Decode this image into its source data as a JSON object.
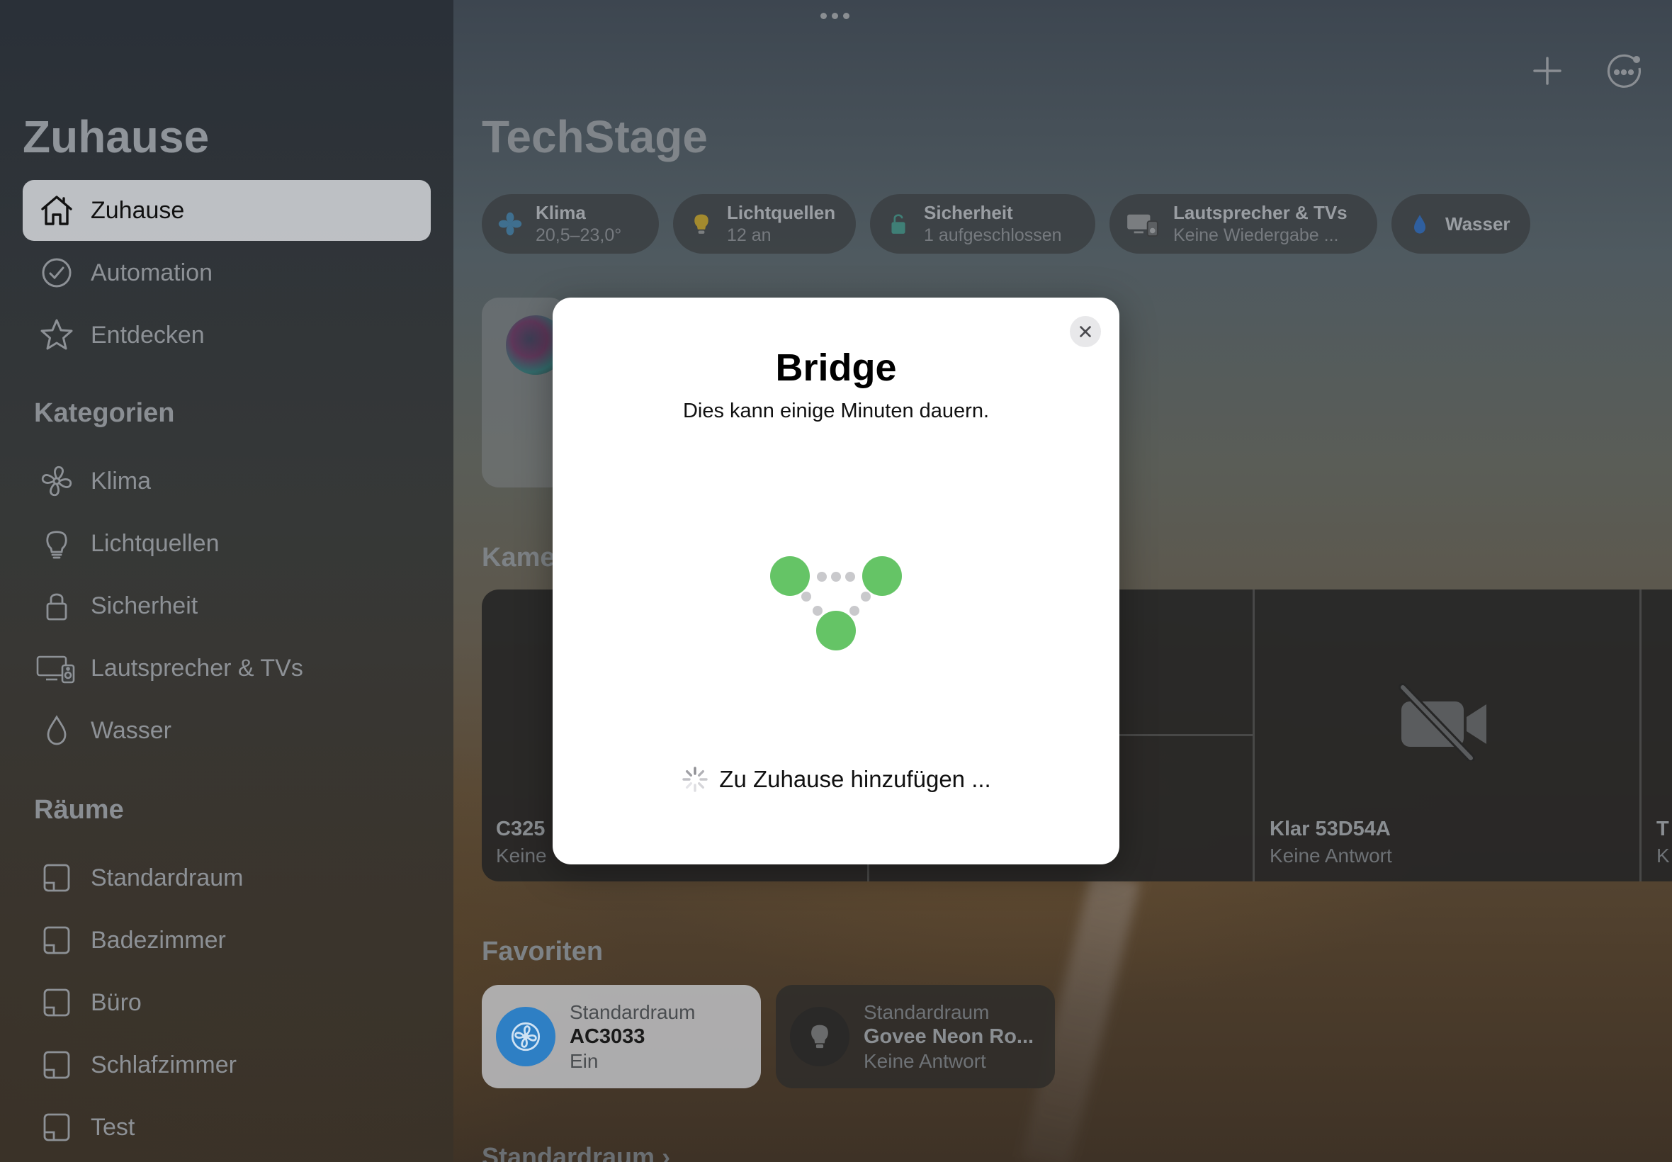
{
  "sidebar": {
    "title": "Zuhause",
    "nav": [
      {
        "label": "Zuhause",
        "icon": "house-icon",
        "active": true
      },
      {
        "label": "Automation",
        "icon": "clock-check-icon"
      },
      {
        "label": "Entdecken",
        "icon": "star-icon"
      }
    ],
    "categories_header": "Kategorien",
    "categories": [
      {
        "label": "Klima",
        "icon": "fan-icon"
      },
      {
        "label": "Lichtquellen",
        "icon": "lightbulb-icon"
      },
      {
        "label": "Sicherheit",
        "icon": "lock-icon"
      },
      {
        "label": "Lautsprecher & TVs",
        "icon": "speaker-tv-icon"
      },
      {
        "label": "Wasser",
        "icon": "water-drop-icon"
      }
    ],
    "rooms_header": "Räume",
    "rooms": [
      {
        "label": "Standardraum",
        "icon": "room-icon"
      },
      {
        "label": "Badezimmer",
        "icon": "room-icon"
      },
      {
        "label": "Büro",
        "icon": "room-icon"
      },
      {
        "label": "Schlafzimmer",
        "icon": "room-icon"
      },
      {
        "label": "Test",
        "icon": "room-icon"
      }
    ]
  },
  "main": {
    "home_title": "TechStage",
    "chips": [
      {
        "title": "Klima",
        "subtitle": "20,5–23,0°",
        "icon": "fan-icon"
      },
      {
        "title": "Lichtquellen",
        "subtitle": "12 an",
        "icon": "lightbulb-icon"
      },
      {
        "title": "Sicherheit",
        "subtitle": "1 aufgeschlossen",
        "icon": "lock-icon"
      },
      {
        "title": "Lautsprecher & TVs",
        "subtitle": "Keine Wiedergabe ...",
        "icon": "speaker-tv-icon"
      },
      {
        "title": "Wasser",
        "subtitle": "",
        "icon": "water-drop-icon"
      }
    ],
    "cameras_label": "Kame",
    "cameras": [
      {
        "title": "C325",
        "subtitle": "Keine"
      },
      {
        "title": "Klar 53D54A",
        "subtitle": "Keine Antwort"
      },
      {
        "title": "T",
        "subtitle": "K"
      }
    ],
    "favorites_label": "Favoriten",
    "favorites": [
      {
        "room": "Standardraum",
        "name": "AC3033",
        "status": "Ein",
        "icon": "fan-icon"
      },
      {
        "room": "Standardraum",
        "name": "Govee Neon Ro...",
        "status": "Keine Antwort",
        "icon": "lightbulb-icon"
      }
    ],
    "bottom_section": "Standardraum"
  },
  "modal": {
    "title": "Bridge",
    "subtitle": "Dies kann einige Minuten dauern.",
    "status": "Zu Zuhause hinzufügen ...",
    "accent_color": "#65c466"
  },
  "colors": {
    "node_green": "#65c466",
    "fav_fan_blue": "#2e7fc4"
  }
}
